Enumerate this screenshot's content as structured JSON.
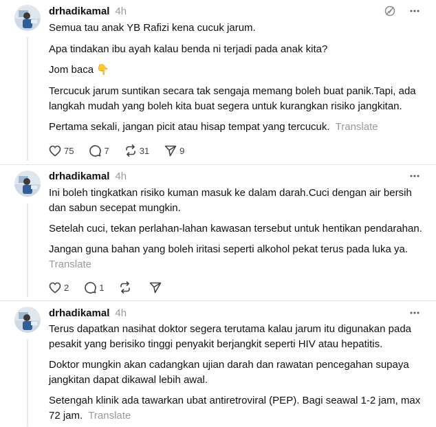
{
  "posts": [
    {
      "username": "drhadikamal",
      "time": "4h",
      "paragraphs": [
        "Semua tau anak YB Rafizi kena cucuk jarum.",
        "Apa tindakan ibu ayah kalau benda ni terjadi pada anak kita?",
        "Jom baca 👇",
        "Tercucuk jarum suntikan secara tak sengaja memang boleh buat panik.Tapi, ada langkah mudah yang boleh kita buat segera untuk kurangkan risiko jangkitan.",
        "Pertama sekali, jangan picit atau hisap tempat yang tercucuk."
      ],
      "translate": "Translate",
      "counts": {
        "likes": "75",
        "replies": "7",
        "reposts": "31",
        "shares": "9"
      }
    },
    {
      "username": "drhadikamal",
      "time": "4h",
      "paragraphs": [
        "Ini boleh tingkatkan risiko kuman masuk ke dalam darah.Cuci dengan air bersih dan sabun secepat mungkin.",
        "Setelah cuci, tekan perlahan-lahan kawasan tersebut untuk hentikan pendarahan.",
        "Jangan guna bahan yang boleh iritasi seperti alkohol pekat terus pada luka ya."
      ],
      "translate": "Translate",
      "counts": {
        "likes": "2",
        "replies": "1",
        "reposts": "",
        "shares": ""
      }
    },
    {
      "username": "drhadikamal",
      "time": "4h",
      "paragraphs": [
        "Terus dapatkan nasihat doktor segera terutama kalau jarum itu digunakan pada pesakit yang berisiko tinggi penyakit berjangkit seperti HIV atau hepatitis.",
        "Doktor mungkin akan cadangkan ujian darah dan rawatan pencegahan supaya jangkitan dapat dikawal lebih awal.",
        "Setengah klinik ada tawarkan ubat antiretroviral (PEP). Bagi seawal 1-2 jam, max 72 jam."
      ],
      "translate": "Translate",
      "counts": {
        "likes": "",
        "replies": "",
        "reposts": "",
        "shares": ""
      }
    }
  ],
  "icons": {
    "like": "heart-icon",
    "reply": "speech-bubble-icon",
    "repost": "repost-arrows-icon",
    "share": "send-paper-plane-icon",
    "more": "more-dots-icon",
    "pinned": "mute-icon"
  },
  "colors": {
    "text": "#101010",
    "muted": "#999999",
    "icon": "#424242",
    "divider": "#e4e4e4",
    "thread_line": "#e6e6e6"
  }
}
